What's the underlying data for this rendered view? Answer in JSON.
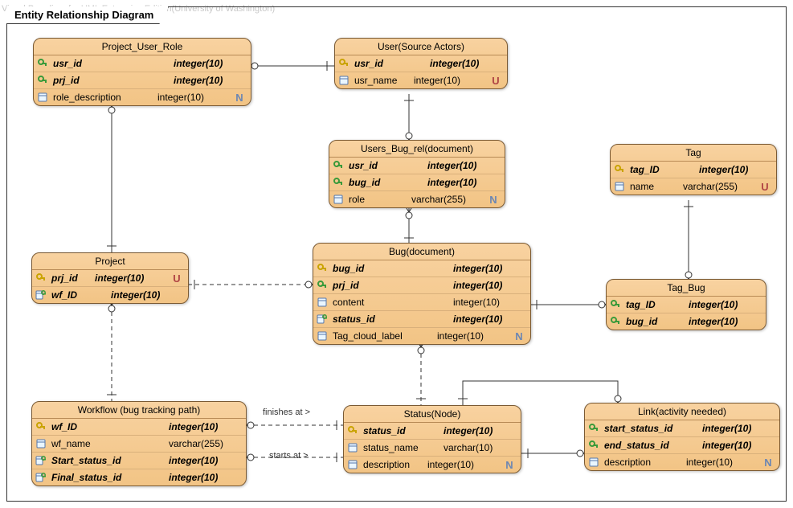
{
  "watermark": "Visual Paradigm for UML Enterprise Edition(University of Washington)",
  "frame_title": "Entity Relationship Diagram",
  "badges": {
    "nullable": "N",
    "unique": "U"
  },
  "relationship_labels": {
    "finishes_at": "finishes at >",
    "starts_at": "starts at >"
  },
  "entities": {
    "project_user_role": {
      "title": "Project_User_Role",
      "rows": [
        {
          "icon": "fk",
          "name": "usr_id",
          "type": "integer(10)",
          "class": "fk"
        },
        {
          "icon": "fk",
          "name": "prj_id",
          "type": "integer(10)",
          "class": "fk"
        },
        {
          "icon": "col",
          "name": "role_description",
          "type": "integer(10)",
          "badge": "N"
        }
      ]
    },
    "user": {
      "title": "User(Source Actors)",
      "rows": [
        {
          "icon": "pk",
          "name": "usr_id",
          "type": "integer(10)",
          "class": "pk"
        },
        {
          "icon": "col",
          "name": "usr_name",
          "type": "integer(10)",
          "badge": "U"
        }
      ]
    },
    "users_bug_rel": {
      "title": "Users_Bug_rel(document)",
      "rows": [
        {
          "icon": "fk",
          "name": "usr_id",
          "type": "integer(10)",
          "class": "fk"
        },
        {
          "icon": "fk",
          "name": "bug_id",
          "type": "integer(10)",
          "class": "fk"
        },
        {
          "icon": "col",
          "name": "role",
          "type": "varchar(255)",
          "badge": "N"
        }
      ]
    },
    "tag": {
      "title": "Tag",
      "rows": [
        {
          "icon": "pk",
          "name": "tag_ID",
          "type": "integer(10)",
          "class": "pk"
        },
        {
          "icon": "col",
          "name": "name",
          "type": "varchar(255)",
          "badge": "U"
        }
      ]
    },
    "project": {
      "title": "Project",
      "rows": [
        {
          "icon": "pk",
          "name": "prj_id",
          "type": "integer(10)",
          "class": "pk",
          "badge": "U"
        },
        {
          "icon": "colfk",
          "name": "wf_ID",
          "type": "integer(10)",
          "class": "fk"
        }
      ]
    },
    "bug": {
      "title": "Bug(document)",
      "rows": [
        {
          "icon": "pk",
          "name": "bug_id",
          "type": "integer(10)",
          "class": "pk"
        },
        {
          "icon": "fk",
          "name": "prj_id",
          "type": "integer(10)",
          "class": "fk"
        },
        {
          "icon": "col",
          "name": "content",
          "type": "integer(10)"
        },
        {
          "icon": "colfk",
          "name": "status_id",
          "type": "integer(10)",
          "class": "fk"
        },
        {
          "icon": "col",
          "name": "Tag_cloud_label",
          "type": "integer(10)",
          "badge": "N"
        }
      ]
    },
    "tag_bug": {
      "title": "Tag_Bug",
      "rows": [
        {
          "icon": "fk",
          "name": "tag_ID",
          "type": "integer(10)",
          "class": "fk"
        },
        {
          "icon": "fk",
          "name": "bug_id",
          "type": "integer(10)",
          "class": "fk"
        }
      ]
    },
    "workflow": {
      "title": "Workflow (bug tracking path)",
      "rows": [
        {
          "icon": "pk",
          "name": "wf_ID",
          "type": "integer(10)",
          "class": "pk"
        },
        {
          "icon": "col",
          "name": "wf_name",
          "type": "varchar(255)"
        },
        {
          "icon": "colfk",
          "name": "Start_status_id",
          "type": "integer(10)",
          "class": "fk"
        },
        {
          "icon": "colfk",
          "name": "Final_status_id",
          "type": "integer(10)",
          "class": "fk"
        }
      ]
    },
    "status": {
      "title": "Status(Node)",
      "rows": [
        {
          "icon": "pk",
          "name": "status_id",
          "type": "integer(10)",
          "class": "pk"
        },
        {
          "icon": "col",
          "name": "status_name",
          "type": "varchar(10)"
        },
        {
          "icon": "col",
          "name": "description",
          "type": "integer(10)",
          "badge": "N"
        }
      ]
    },
    "link": {
      "title": "Link(activity needed)",
      "rows": [
        {
          "icon": "fk",
          "name": "start_status_id",
          "type": "integer(10)",
          "class": "fk"
        },
        {
          "icon": "fk",
          "name": "end_status_id",
          "type": "integer(10)",
          "class": "fk"
        },
        {
          "icon": "col",
          "name": "description",
          "type": "integer(10)",
          "badge": "N"
        }
      ]
    }
  },
  "chart_data": {
    "type": "erd",
    "entities": [
      "Project_User_Role",
      "User(Source Actors)",
      "Users_Bug_rel(document)",
      "Tag",
      "Project",
      "Bug(document)",
      "Tag_Bug",
      "Workflow (bug tracking path)",
      "Status(Node)",
      "Link(activity needed)"
    ],
    "relationships": [
      {
        "from": "Project_User_Role",
        "to": "User(Source Actors)",
        "from_card": "many",
        "to_card": "one",
        "style": "solid"
      },
      {
        "from": "Project_User_Role",
        "to": "Project",
        "from_card": "many",
        "to_card": "one",
        "style": "solid"
      },
      {
        "from": "Users_Bug_rel(document)",
        "to": "User(Source Actors)",
        "from_card": "many",
        "to_card": "one",
        "style": "solid"
      },
      {
        "from": "Users_Bug_rel(document)",
        "to": "Bug(document)",
        "from_card": "many",
        "to_card": "one",
        "style": "solid"
      },
      {
        "from": "Bug(document)",
        "to": "Project",
        "from_card": "many",
        "to_card": "one",
        "style": "dashed"
      },
      {
        "from": "Bug(document)",
        "to": "Status(Node)",
        "from_card": "many",
        "to_card": "one",
        "style": "dashed"
      },
      {
        "from": "Tag_Bug",
        "to": "Tag",
        "from_card": "many",
        "to_card": "one",
        "style": "solid"
      },
      {
        "from": "Tag_Bug",
        "to": "Bug(document)",
        "from_card": "many",
        "to_card": "one",
        "style": "solid"
      },
      {
        "from": "Project",
        "to": "Workflow (bug tracking path)",
        "from_card": "many",
        "to_card": "one",
        "style": "dashed"
      },
      {
        "from": "Workflow (bug tracking path)",
        "to": "Status(Node)",
        "label": "finishes at >",
        "from_card": "many",
        "to_card": "one",
        "style": "dashed"
      },
      {
        "from": "Workflow (bug tracking path)",
        "to": "Status(Node)",
        "label": "starts at >",
        "from_card": "many",
        "to_card": "one",
        "style": "dashed"
      },
      {
        "from": "Link(activity needed)",
        "to": "Status(Node)",
        "from_card": "many",
        "to_card": "one",
        "style": "solid",
        "note": "start_status_id"
      },
      {
        "from": "Link(activity needed)",
        "to": "Status(Node)",
        "from_card": "many",
        "to_card": "one",
        "style": "solid",
        "note": "end_status_id"
      }
    ]
  }
}
